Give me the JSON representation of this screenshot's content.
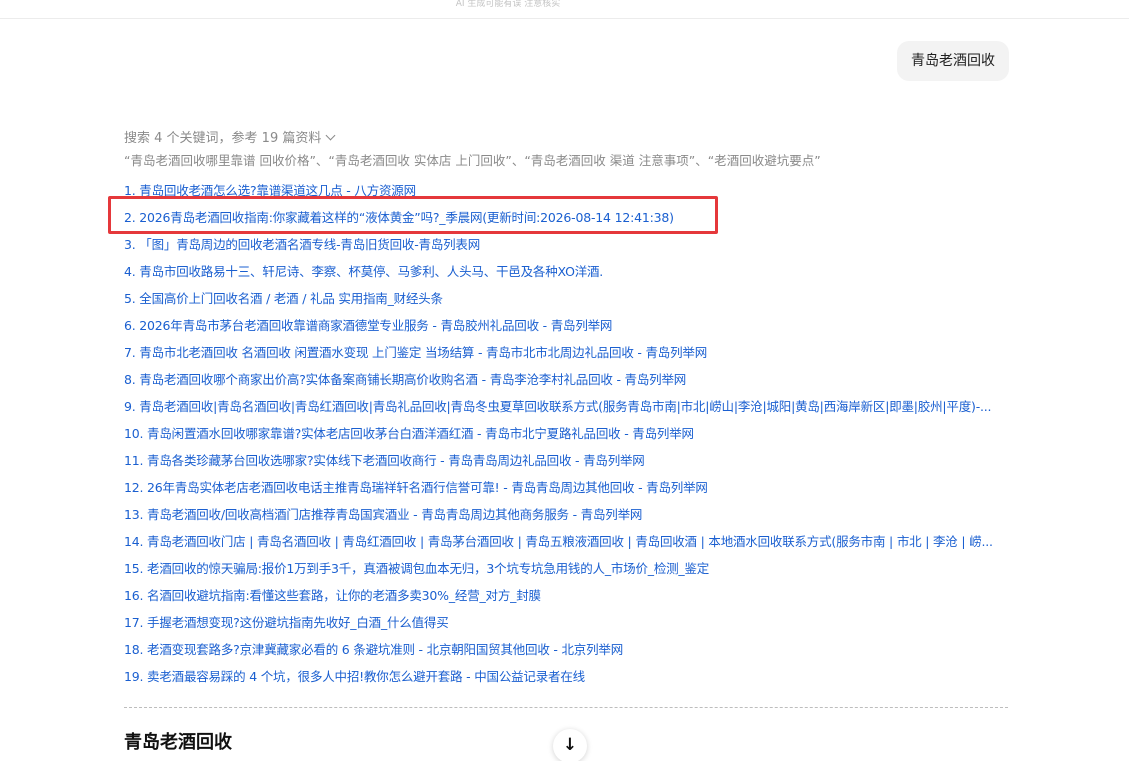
{
  "top_notice": "AI 生成可能有误 注意核实",
  "user_query": "青岛老酒回收",
  "search_summary": "搜索 4 个关键词，参考 19 篇资料",
  "keywords_line": "“青岛老酒回收哪里靠谱 回收价格”、“青岛老酒回收 实体店 上门回收”、“青岛老酒回收 渠道 注意事项”、“老酒回收避坑要点”",
  "highlighted_index": 2,
  "results": [
    "1.   青岛回收老酒怎么选?靠谱渠道这几点 - 八方资源网",
    "2.   2026青岛老酒回收指南:你家藏着这样的“液体黄金”吗?_季晨网(更新时间:2026-08-14 12:41:38)",
    "3.   「图」青岛周边的回收老酒名酒专线-青岛旧货回收-青岛列表网",
    "4.   青岛市回收路易十三、轩尼诗、李察、杯莫停、马爹利、人头马、干邑及各种XO洋酒.",
    "5.   全国高价上门回收名酒 / 老酒 / 礼品 实用指南_财经头条",
    "6.   2026年青岛市茅台老酒回收靠谱商家酒德堂专业服务 - 青岛胶州礼品回收 - 青岛列举网",
    "7.   青岛市北老酒回收 名酒回收 闲置酒水变现 上门鉴定 当场结算 - 青岛市北市北周边礼品回收 - 青岛列举网",
    "8.   青岛老酒回收哪个商家出价高?实体备案商铺长期高价收购名酒 - 青岛李沧李村礼品回收 - 青岛列举网",
    "9.   青岛老酒回收|青岛名酒回收|青岛红酒回收|青岛礼品回收|青岛冬虫夏草回收联系方式(服务青岛市南|市北|崂山|李沧|城阳|黄岛|西海岸新区|即墨|胶州|平度)-...",
    "10. 青岛闲置酒水回收哪家靠谱?实体老店回收茅台白酒洋酒红酒 - 青岛市北宁夏路礼品回收 - 青岛列举网",
    "11. 青岛各类珍藏茅台回收选哪家?实体线下老酒回收商行 - 青岛青岛周边礼品回收 - 青岛列举网",
    "12. 26年青岛实体老店老酒回收电话主推青岛瑞祥轩名酒行信誉可靠! - 青岛青岛周边其他回收 - 青岛列举网",
    "13. 青岛老酒回收/回收高档酒门店推荐青岛国宾酒业 - 青岛青岛周边其他商务服务 - 青岛列举网",
    "14. 青岛老酒回收门店 | 青岛名酒回收 | 青岛红酒回收 | 青岛茅台酒回收 | 青岛五粮液酒回收 | 青岛回收酒 | 本地酒水回收联系方式(服务市南 | 市北 | 李沧 | 崂...",
    "15. 老酒回收的惊天骗局:报价1万到手3千，真酒被调包血本无归，3个坑专坑急用钱的人_市场价_检测_鉴定",
    "16. 名酒回收避坑指南:看懂这些套路，让你的老酒多卖30%_经营_对方_封膜",
    "17. 手握老酒想变现?这份避坑指南先收好_白酒_什么值得买",
    "18. 老酒变现套路多?京津冀藏家必看的 6 条避坑准则 - 北京朝阳国贸其他回收 - 北京列举网",
    "19. 卖老酒最容易踩的 4 个坑，很多人中招!教你怎么避开套路 - 中国公益记录者在线"
  ],
  "section_heading": "青岛老酒回收",
  "scroll_button_icon": "arrow-down-icon",
  "scroll_button_glyph": "↓",
  "colors": {
    "link": "#1a5fd0",
    "highlight": "#e5383b",
    "muted": "#8a8a8a",
    "bubble": "#f3f3f3"
  }
}
